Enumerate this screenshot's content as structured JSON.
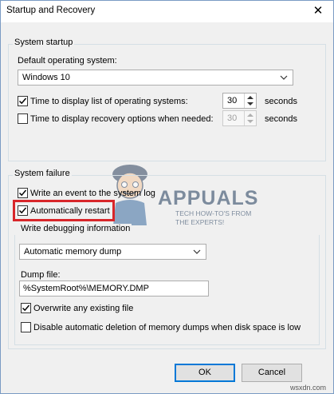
{
  "dialog": {
    "title": "Startup and Recovery",
    "close_glyph": "✕"
  },
  "system_startup": {
    "group_label": "System startup",
    "default_os_label": "Default operating system:",
    "default_os_value": "Windows 10",
    "time_list_label": "Time to display list of operating systems:",
    "time_list_checked": true,
    "time_list_value": "30",
    "time_list_unit": "seconds",
    "time_recovery_label": "Time to display recovery options when needed:",
    "time_recovery_checked": false,
    "time_recovery_value": "30",
    "time_recovery_unit": "seconds"
  },
  "system_failure": {
    "group_label": "System failure",
    "write_event_label": "Write an event to the system log",
    "write_event_checked": true,
    "auto_restart_label": "Automatically restart",
    "auto_restart_checked": true,
    "debug_group_label": "Write debugging information",
    "debug_type_value": "Automatic memory dump",
    "dump_file_label": "Dump file:",
    "dump_file_value": "%SystemRoot%\\MEMORY.DMP",
    "overwrite_label": "Overwrite any existing file",
    "overwrite_checked": true,
    "disable_auto_delete_label": "Disable automatic deletion of memory dumps when disk space is low",
    "disable_auto_delete_checked": false
  },
  "buttons": {
    "ok": "OK",
    "cancel": "Cancel"
  },
  "watermark": {
    "brand": "APPUALS",
    "tagline_1": "TECH HOW-TO'S FROM",
    "tagline_2": "THE EXPERTS!"
  },
  "colors": {
    "highlight_box": "#d8262a",
    "default_button_border": "#0078d7"
  },
  "corner_watermark": "wsxdn.com"
}
